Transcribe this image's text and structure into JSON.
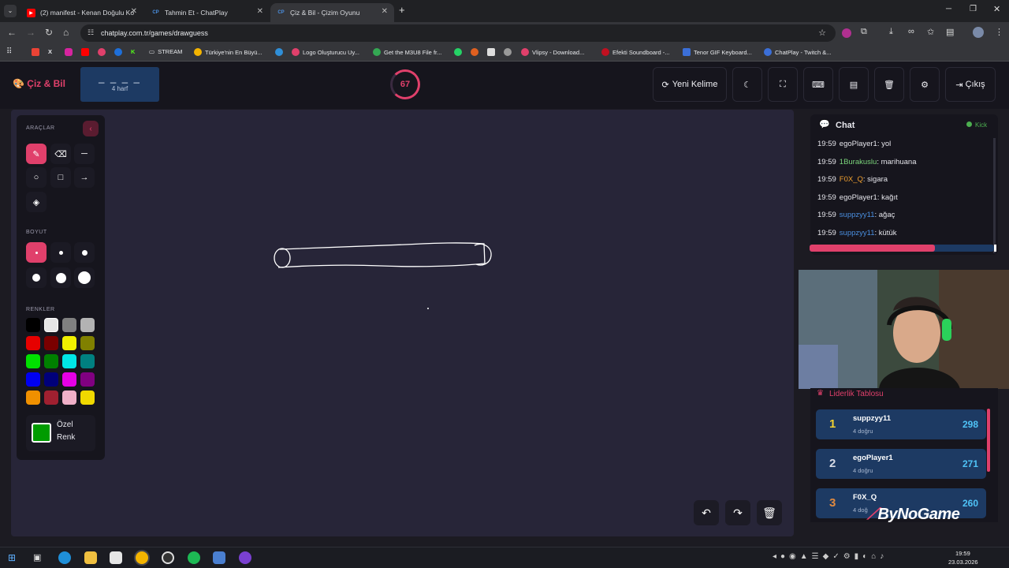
{
  "browser": {
    "tabs": [
      {
        "title": "(2) manifest - Kenan Doğulu Ko",
        "icon": "youtube-icon",
        "color": "#ff0000"
      },
      {
        "title": "Tahmin Et - ChatPlay",
        "icon": "chatplay-icon",
        "color": "#3b6fd8"
      },
      {
        "title": "Çiz & Bil - Çizim Oyunu",
        "icon": "chatplay-icon",
        "color": "#3b6fd8"
      }
    ],
    "url": "chatplay.com.tr/games/drawguess",
    "bookmarks": [
      {
        "label": "STREAM",
        "color": "#e8eaed"
      },
      {
        "label": "Türkiye'nin En Büyü...",
        "color": "#f4b400"
      },
      {
        "label": "Logo Oluşturucu Uy...",
        "color": "#e0406b"
      },
      {
        "label": "Get the M3U8 File fr...",
        "color": "#34a853"
      },
      {
        "label": "Vlipsy - Download...",
        "color": "#e0406b"
      },
      {
        "label": "Efekti Soundboard -...",
        "color": "#c01020"
      },
      {
        "label": "Tenor GIF Keyboard...",
        "color": "#3b6fd8"
      },
      {
        "label": "ChatPlay - Twitch &...",
        "color": "#3b6fd8"
      }
    ]
  },
  "app": {
    "logo": "Çiz & Bil",
    "word_mask": "_ _ _ _",
    "word_hint": "4 harf",
    "timer": "67",
    "buttons": {
      "new_word": "Yeni Kelime",
      "exit": "Çıkış"
    }
  },
  "tools": {
    "title": "ARAÇLAR",
    "size_title": "BOYUT",
    "color_title": "RENKLER",
    "palette": [
      "#000000",
      "#e6e6e6",
      "#808080",
      "#b3b3b3",
      "#e60000",
      "#7a0000",
      "#f0f000",
      "#808000",
      "#00e000",
      "#008000",
      "#00e6e6",
      "#008080",
      "#0000f0",
      "#00007a",
      "#e600e6",
      "#800080",
      "#f09000",
      "#a02030",
      "#f0b0c8",
      "#f0d800"
    ],
    "custom_label_1": "Özel",
    "custom_label_2": "Renk",
    "custom_color": "#009b00"
  },
  "chat": {
    "title": "Chat",
    "status": "Kick",
    "messages": [
      {
        "time": "19:59",
        "user": "egoPlayer1",
        "user_color": "#e4e4ea",
        "text": ": yol"
      },
      {
        "time": "19:59",
        "user": "1Burakuslu",
        "user_color": "#7ad37a",
        "text": ": marihuana"
      },
      {
        "time": "19:59",
        "user": "F0X_Q",
        "user_color": "#f0a030",
        "text": ": sigara"
      },
      {
        "time": "19:59",
        "user": "egoPlayer1",
        "user_color": "#e4e4ea",
        "text": ": kağıt"
      },
      {
        "time": "19:59",
        "user": "suppzyy11",
        "user_color": "#4a8fe0",
        "text": ": ağaç"
      },
      {
        "time": "19:59",
        "user": "suppzyy11",
        "user_color": "#4a8fe0",
        "text": ": kütük"
      }
    ],
    "progress": 0.68
  },
  "leaderboard": {
    "title": "Liderlik Tablosu",
    "rows": [
      {
        "rank": "1",
        "rank_color": "#f0d030",
        "name": "suppzyy11",
        "sub": "4 doğru",
        "score": "298"
      },
      {
        "rank": "2",
        "rank_color": "#d8dce6",
        "name": "egoPlayer1",
        "sub": "4 doğru",
        "score": "271"
      },
      {
        "rank": "3",
        "rank_color": "#e08a40",
        "name": "F0X_Q",
        "sub": "4 doğ",
        "score": "260"
      }
    ]
  },
  "watermark": "ByNoGame",
  "taskbar": {
    "time": "19:59",
    "date": "23.03.2026"
  }
}
